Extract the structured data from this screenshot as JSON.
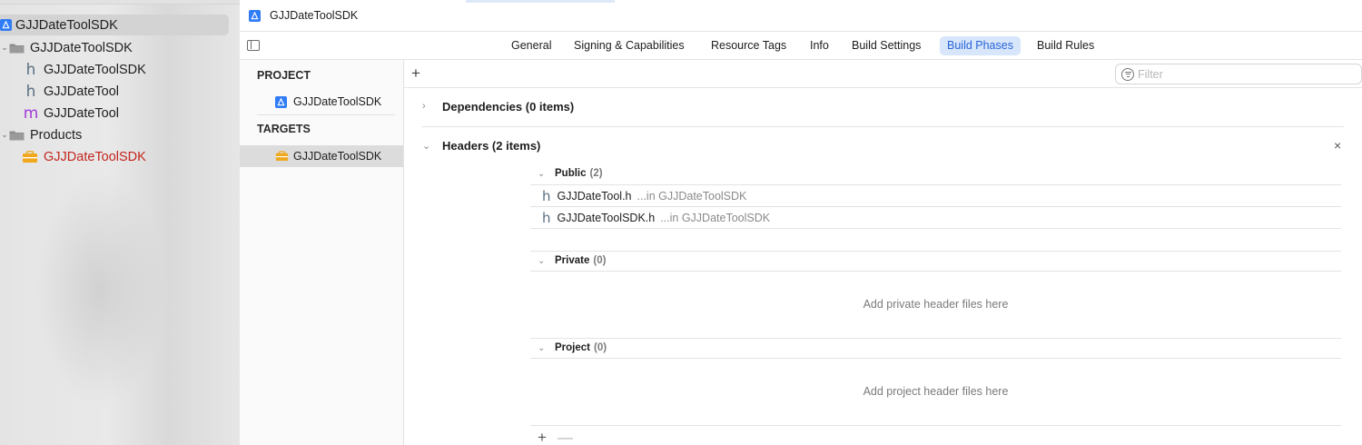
{
  "navigator": {
    "root": "GJJDateToolSDK",
    "group": "GJJDateToolSDK",
    "files": [
      {
        "kind": "h",
        "name": "GJJDateToolSDK"
      },
      {
        "kind": "h",
        "name": "GJJDateTool"
      },
      {
        "kind": "m",
        "name": "GJJDateTool"
      }
    ],
    "products_group": "Products",
    "product": "GJJDateToolSDK",
    "product_color": "#c2261f"
  },
  "editor": {
    "crumb_title": "GJJDateToolSDK",
    "tabs": [
      "General",
      "Signing & Capabilities",
      "Resource Tags",
      "Info",
      "Build Settings",
      "Build Phases",
      "Build Rules"
    ],
    "active_tab": "Build Phases",
    "accent_color": "#2865d8"
  },
  "targets": {
    "project_header": "PROJECT",
    "project_name": "GJJDateToolSDK",
    "targets_header": "TARGETS",
    "target_name": "GJJDateToolSDK"
  },
  "phases": {
    "add_symbol": "+",
    "filter_placeholder": "Filter",
    "dependencies": "Dependencies (0 items)",
    "headers": "Headers (2 items)",
    "close_symbol": "×",
    "public": {
      "label": "Public",
      "count": "(2)"
    },
    "public_files": [
      {
        "name": "GJJDateTool.h",
        "location": "...in GJJDateToolSDK"
      },
      {
        "name": "GJJDateToolSDK.h",
        "location": "...in GJJDateToolSDK"
      }
    ],
    "private": {
      "label": "Private",
      "count": "(0)",
      "hint": "Add private header files here"
    },
    "project": {
      "label": "Project",
      "count": "(0)",
      "hint": "Add project header files here"
    },
    "add_button": "+",
    "remove_button": "—"
  }
}
